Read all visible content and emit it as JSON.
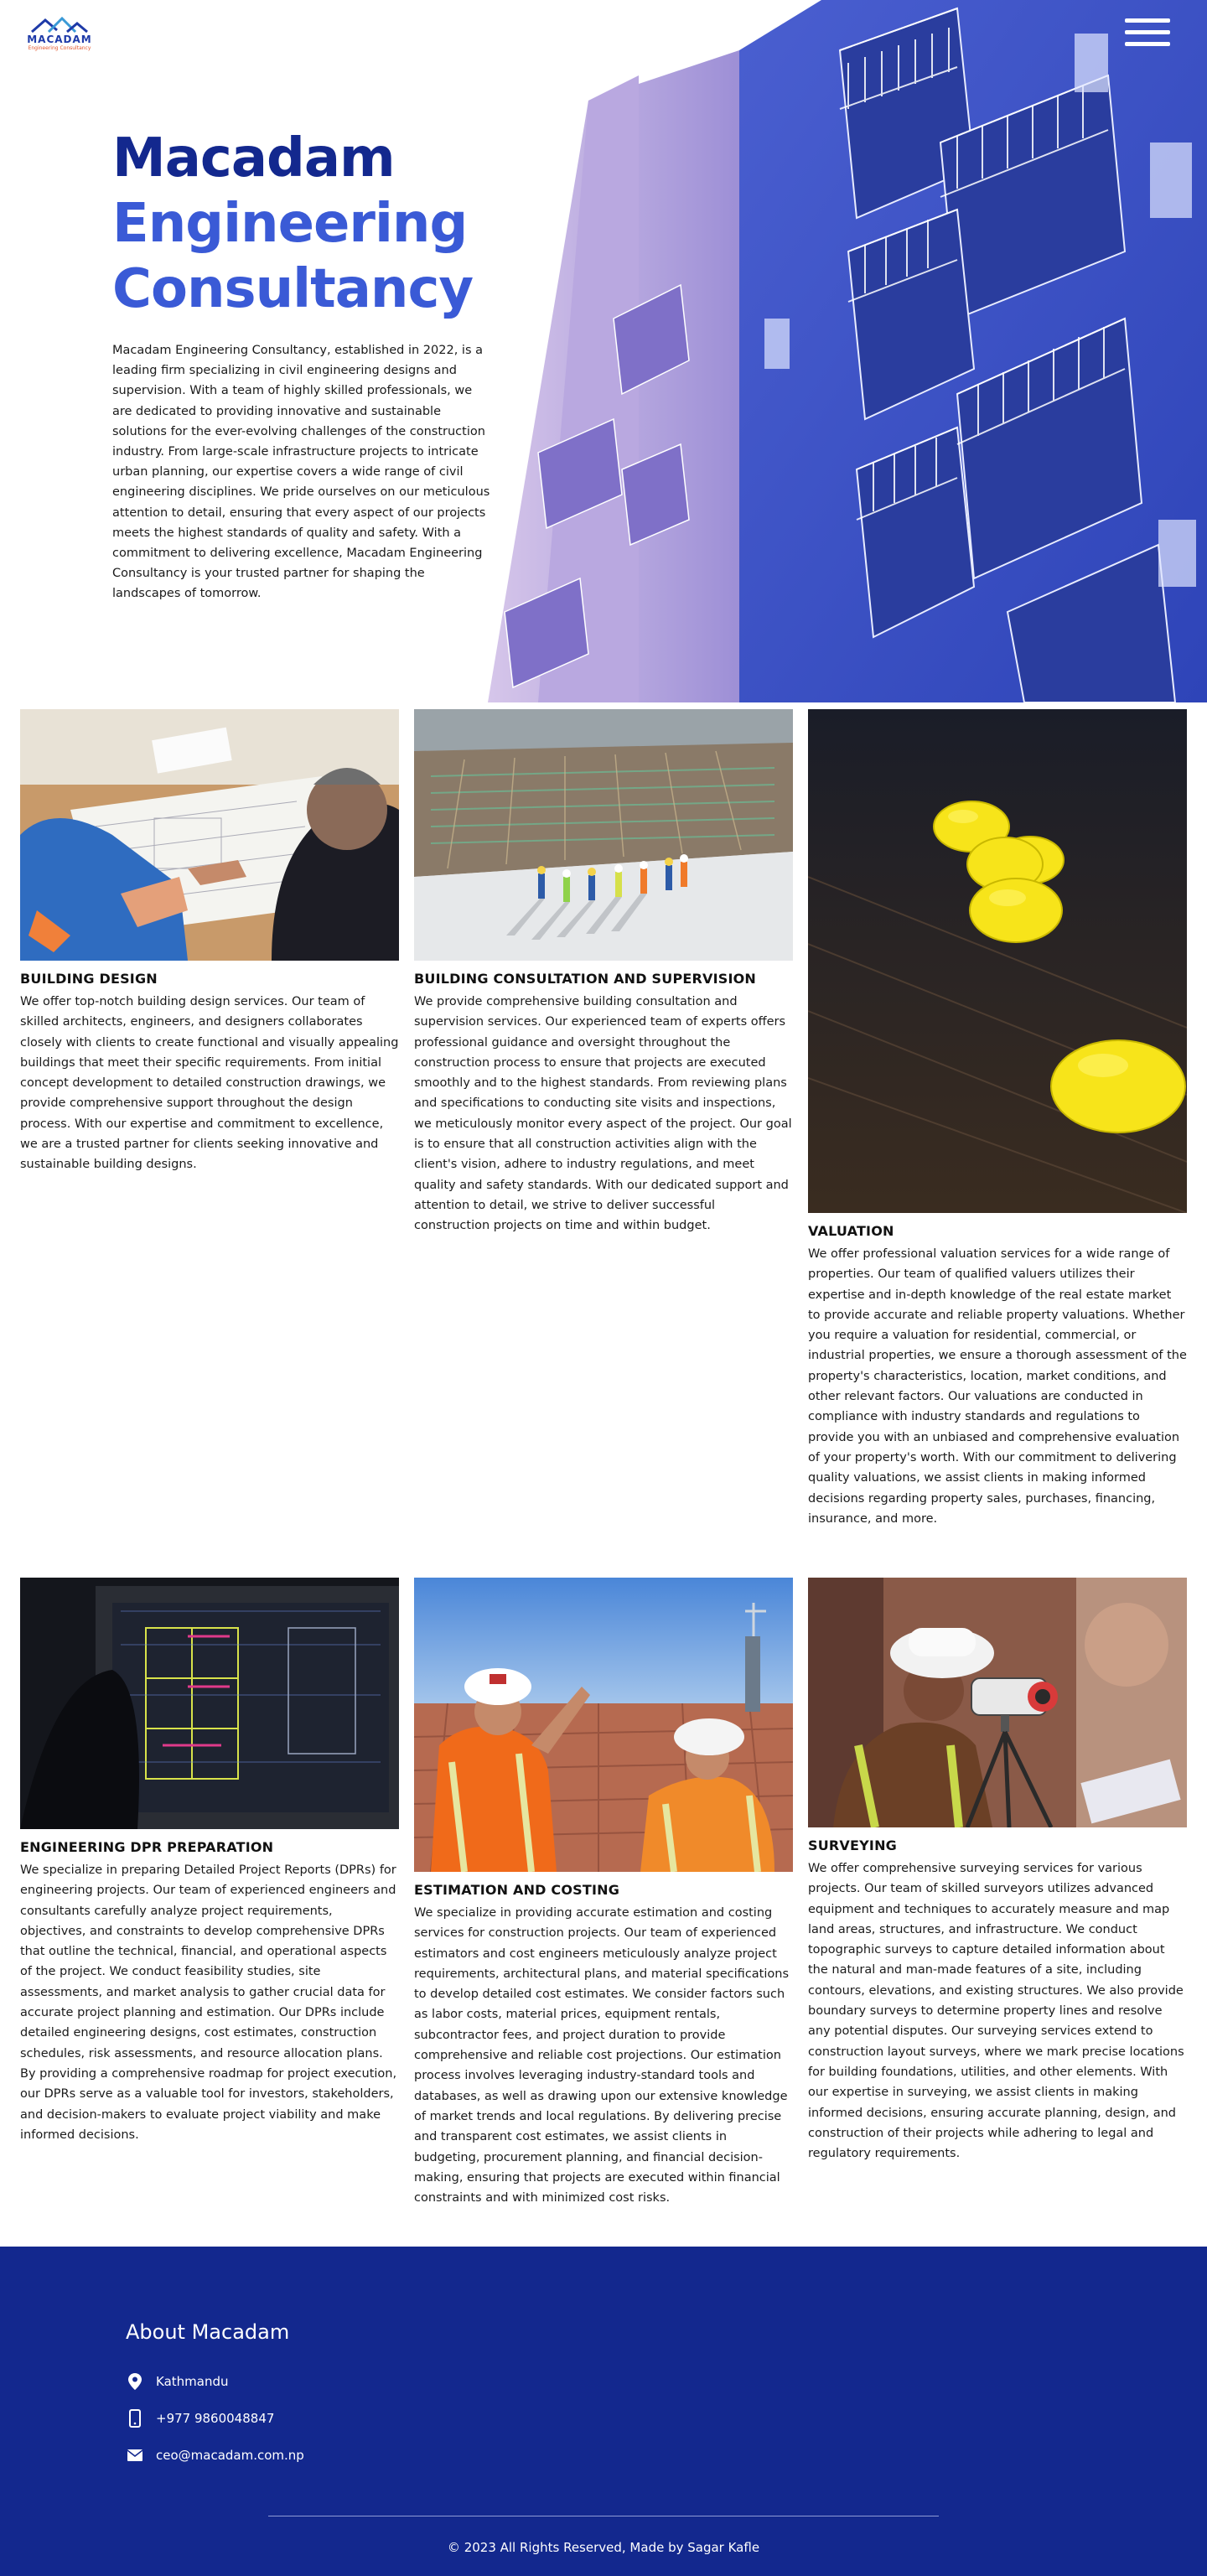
{
  "brand": {
    "logo_text": "MACADAM",
    "logo_subtitle": "Engineering Consultancy"
  },
  "hero": {
    "title_line1": "Macadam",
    "title_line2": "Engineering",
    "title_line3": "Consultancy",
    "description": "Macadam Engineering Consultancy, established in 2022, is a leading firm specializing in civil engineering designs and supervision. With a team of highly skilled professionals, we are dedicated to providing innovative and sustainable solutions for the ever-evolving challenges of the construction industry. From large-scale infrastructure projects to intricate urban planning, our expertise covers a wide range of civil engineering disciplines. We pride ourselves on our meticulous attention to detail, ensuring that every aspect of our projects meets the highest standards of quality and safety. With a commitment to delivering excellence, Macadam Engineering Consultancy is your trusted partner for shaping the landscapes of tomorrow."
  },
  "services": [
    {
      "title": "BUILDING DESIGN",
      "image": "architects-reviewing-blueprints",
      "text": "We offer top-notch building design services. Our team of skilled architects, engineers, and designers collaborates closely with clients to create functional and visually appealing buildings that meet their specific requirements. From initial concept development to detailed construction drawings, we provide comprehensive support throughout the design process. With our expertise and commitment to excellence, we are a trusted partner for clients seeking innovative and sustainable building designs."
    },
    {
      "title": "BUILDING CONSULTATION AND SUPERVISION",
      "image": "workers-on-construction-site",
      "text": "We provide comprehensive building consultation and supervision services. Our experienced team of experts offers professional guidance and oversight throughout the construction process to ensure that projects are executed smoothly and to the highest standards. From reviewing plans and specifications to conducting site visits and inspections, we meticulously monitor every aspect of the project. Our goal is to ensure that all construction activities align with the client's vision, adhere to industry regulations, and meet quality and safety standards. With our dedicated support and attention to detail, we strive to deliver successful construction projects on time and within budget."
    },
    {
      "title": "VALUATION",
      "image": "yellow-hard-hats",
      "text": "We offer professional valuation services for a wide range of properties. Our team of qualified valuers utilizes their expertise and in-depth knowledge of the real estate market to provide accurate and reliable property valuations. Whether you require a valuation for residential, commercial, or industrial properties, we ensure a thorough assessment of the property's characteristics, location, market conditions, and other relevant factors. Our valuations are conducted in compliance with industry standards and regulations to provide you with an unbiased and comprehensive evaluation of your property's worth. With our commitment to delivering quality valuations, we assist clients in making informed decisions regarding property sales, purchases, financing, insurance, and more."
    },
    {
      "title": "ENGINEERING DPR PREPARATION",
      "image": "cad-drawing-on-monitor",
      "text": "We specialize in preparing Detailed Project Reports (DPRs) for engineering projects. Our team of experienced engineers and consultants carefully analyze project requirements, objectives, and constraints to develop comprehensive DPRs that outline the technical, financial, and operational aspects of the project. We conduct feasibility studies, site assessments, and market analysis to gather crucial data for accurate project planning and estimation. Our DPRs include detailed engineering designs, cost estimates, construction schedules, risk assessments, and resource allocation plans. By providing a comprehensive roadmap for project execution, our DPRs serve as a valuable tool for investors, stakeholders, and decision-makers to evaluate project viability and make informed decisions."
    },
    {
      "title": "ESTIMATION AND COSTING",
      "image": "engineers-in-safety-vests",
      "text": "We specialize in providing accurate estimation and costing services for construction projects. Our team of experienced estimators and cost engineers meticulously analyze project requirements, architectural plans, and material specifications to develop detailed cost estimates. We consider factors such as labor costs, material prices, equipment rentals, subcontractor fees, and project duration to provide comprehensive and reliable cost projections. Our estimation process involves leveraging industry-standard tools and databases, as well as drawing upon our extensive knowledge of market trends and local regulations. By delivering precise and transparent cost estimates, we assist clients in budgeting, procurement planning, and financial decision-making, ensuring that projects are executed within financial constraints and with minimized cost risks."
    },
    {
      "title": "SURVEYING",
      "image": "surveyor-with-level-instrument",
      "text": "We offer comprehensive surveying services for various projects. Our team of skilled surveyors utilizes advanced equipment and techniques to accurately measure and map land areas, structures, and infrastructure. We conduct topographic surveys to capture detailed information about the natural and man-made features of a site, including contours, elevations, and existing structures. We also provide boundary surveys to determine property lines and resolve any potential disputes. Our surveying services extend to construction layout surveys, where we mark precise locations for building foundations, utilities, and other elements. With our expertise in surveying, we assist clients in making informed decisions, ensuring accurate planning, design, and construction of their projects while adhering to legal and regulatory requirements."
    }
  ],
  "footer": {
    "about_title": "About Macadam",
    "location": "Kathmandu",
    "phone": "+977 9860048847",
    "email": "ceo@macadam.com.np",
    "copyright": "© 2023 All Rights Reserved, Made by Sagar Kafle"
  },
  "colors": {
    "brand_dark": "#13288e",
    "brand_light": "#3a5ad6",
    "footer_bg": "#13288e"
  },
  "icons": [
    "menu-icon",
    "location-pin-icon",
    "phone-icon",
    "envelope-icon"
  ]
}
